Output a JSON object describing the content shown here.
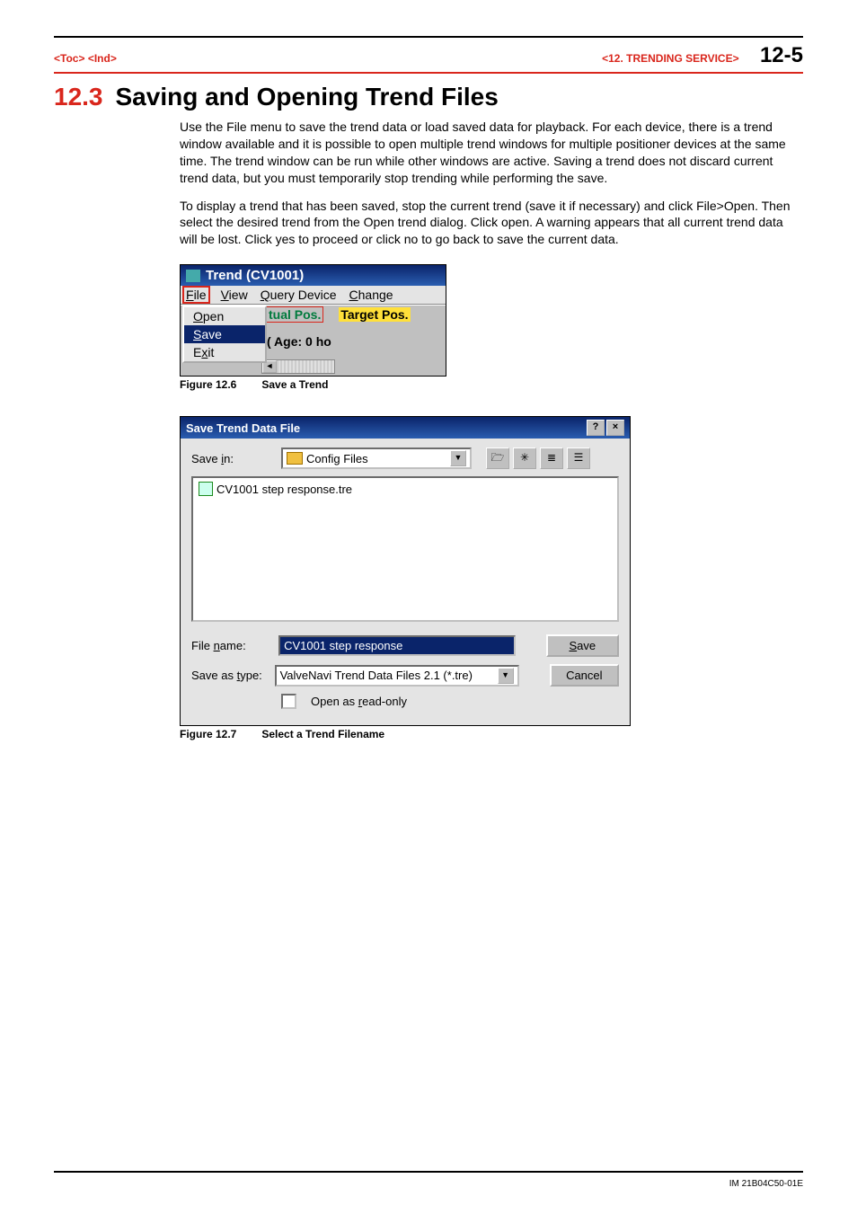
{
  "header": {
    "toc": "<Toc>",
    "ind": "<Ind>",
    "chapter_ref": "<12.  TRENDING SERVICE>",
    "page_number": "12-5"
  },
  "section": {
    "number": "12.3",
    "title": "Saving and Opening Trend Files"
  },
  "paragraphs": {
    "p1": "Use the File menu to save the trend data or load saved data for playback.  For each device, there is a trend window available and it is possible to open multiple trend windows for multiple positioner devices at the same time. The trend window can be run while other windows are active. Saving a trend does not discard current trend data, but you must temporarily stop trending while performing the save.",
    "p2": "To display a trend that has been saved, stop the current trend (save it if necessary) and click File>Open.  Then select the desired trend from the Open trend dialog.  Click open.  A warning appears that all current trend data will be lost.  Click yes to proceed or click no to go back to save the current data."
  },
  "trend_window": {
    "title": "Trend (CV1001)",
    "menu": {
      "file": "File",
      "view": "View",
      "query": "Query Device",
      "change": "Change"
    },
    "file_menu": {
      "open": "Open",
      "save": "Save",
      "exit": "Exit"
    },
    "tual_pos": "tual Pos.",
    "target_pos": "Target Pos.",
    "age": "( Age:  0 ho"
  },
  "fig1": {
    "num": "Figure 12.6",
    "caption": "Save a Trend"
  },
  "save_dialog": {
    "title": "Save Trend Data File",
    "save_in_label": "Save in:",
    "save_in_value": "Config Files",
    "file_item": "CV1001 step response.tre",
    "filename_label": "File name:",
    "filename_value": "CV1001 step response",
    "type_label": "Save as type:",
    "type_value": "ValveNavi Trend Data Files 2.1 (*.tre)",
    "readonly_label": "Open as read-only",
    "save_btn": "Save",
    "cancel_btn": "Cancel"
  },
  "fig2": {
    "num": "Figure 12.7",
    "caption": "Select a Trend Filename"
  },
  "footer": {
    "doc_id": "IM 21B04C50-01E"
  }
}
